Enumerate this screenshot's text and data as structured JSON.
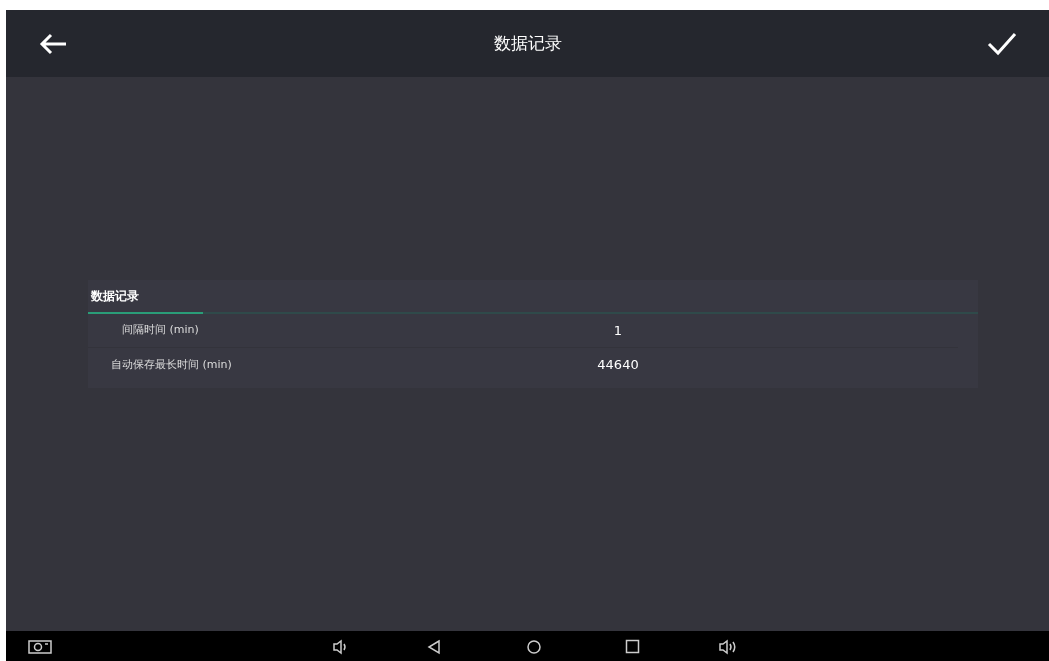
{
  "window": {
    "title": "数据记录"
  },
  "tabs": [
    {
      "label": "数据记录",
      "selected": true
    }
  ],
  "rows": [
    {
      "label": "间隔时间 (min)",
      "value": "1",
      "indented": true
    },
    {
      "label": "自动保存最长时间 (min)",
      "value": "44640",
      "indented": false
    }
  ]
}
